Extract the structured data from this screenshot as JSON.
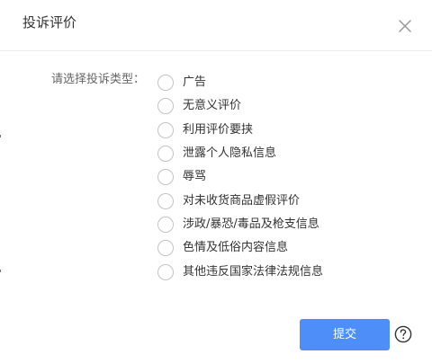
{
  "dialog": {
    "title": "投诉评价",
    "close_icon": "close-icon",
    "form_label": "请选择投诉类型：",
    "options": [
      {
        "label": "广告",
        "selected": false
      },
      {
        "label": "无意义评价",
        "selected": false
      },
      {
        "label": "利用评价要挟",
        "selected": false
      },
      {
        "label": "泄露个人隐私信息",
        "selected": false
      },
      {
        "label": "辱骂",
        "selected": false
      },
      {
        "label": "对未收货商品虚假评价",
        "selected": false
      },
      {
        "label": "涉政/暴恐/毒品及枪支信息",
        "selected": false
      },
      {
        "label": "色情及低俗内容信息",
        "selected": false
      },
      {
        "label": "其他违反国家法律法规信息",
        "selected": false
      }
    ],
    "submit_label": "提交",
    "help_icon": "question-circle-icon"
  },
  "colors": {
    "accent": "#4d8ef8",
    "radio_border": "#c4c4c4",
    "divider": "#ebebeb"
  }
}
